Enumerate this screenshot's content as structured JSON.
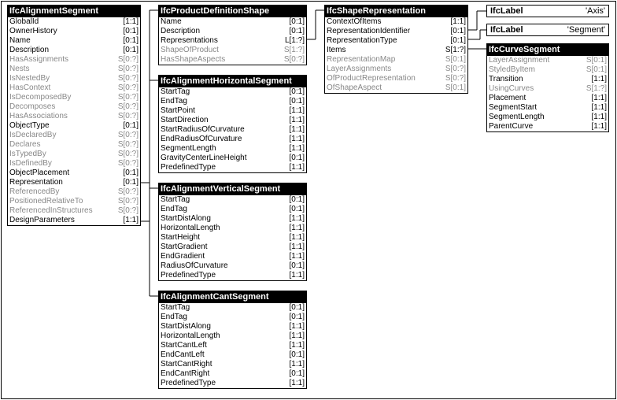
{
  "entities": {
    "alignSeg": {
      "title": "IfcAlignmentSegment",
      "rows": [
        {
          "name": "GlobalId",
          "card": "[1:1]",
          "grey": false
        },
        {
          "name": "OwnerHistory",
          "card": "[0:1]",
          "grey": false
        },
        {
          "name": "Name",
          "card": "[0:1]",
          "grey": false
        },
        {
          "name": "Description",
          "card": "[0:1]",
          "grey": false
        },
        {
          "name": "HasAssignments",
          "card": "S[0:?]",
          "grey": true
        },
        {
          "name": "Nests",
          "card": "S[0:?]",
          "grey": true
        },
        {
          "name": "IsNestedBy",
          "card": "S[0:?]",
          "grey": true
        },
        {
          "name": "HasContext",
          "card": "S[0:?]",
          "grey": true
        },
        {
          "name": "IsDecomposedBy",
          "card": "S[0:?]",
          "grey": true
        },
        {
          "name": "Decomposes",
          "card": "S[0:?]",
          "grey": true
        },
        {
          "name": "HasAssociations",
          "card": "S[0:?]",
          "grey": true
        },
        {
          "name": "ObjectType",
          "card": "[0:1]",
          "grey": false
        },
        {
          "name": "IsDeclaredBy",
          "card": "S[0:?]",
          "grey": true
        },
        {
          "name": "Declares",
          "card": "S[0:?]",
          "grey": true
        },
        {
          "name": "IsTypedBy",
          "card": "S[0:?]",
          "grey": true
        },
        {
          "name": "IsDefinedBy",
          "card": "S[0:?]",
          "grey": true
        },
        {
          "name": "ObjectPlacement",
          "card": "[0:1]",
          "grey": false
        },
        {
          "name": "Representation",
          "card": "[0:1]",
          "grey": false
        },
        {
          "name": "ReferencedBy",
          "card": "S[0:?]",
          "grey": true
        },
        {
          "name": "PositionedRelativeTo",
          "card": "S[0:?]",
          "grey": true
        },
        {
          "name": "ReferencedInStructures",
          "card": "S[0:?]",
          "grey": true
        },
        {
          "name": "DesignParameters",
          "card": "[1:1]",
          "grey": false
        }
      ]
    },
    "prodDef": {
      "title": "IfcProductDefinitionShape",
      "rows": [
        {
          "name": "Name",
          "card": "[0:1]",
          "grey": false
        },
        {
          "name": "Description",
          "card": "[0:1]",
          "grey": false
        },
        {
          "name": "Representations",
          "card": "L[1:?]",
          "grey": false
        },
        {
          "name": "ShapeOfProduct",
          "card": "S[1:?]",
          "grey": true
        },
        {
          "name": "HasShapeAspects",
          "card": "S[0:?]",
          "grey": true
        }
      ]
    },
    "horiz": {
      "title": "IfcAlignmentHorizontalSegment",
      "rows": [
        {
          "name": "StartTag",
          "card": "[0:1]",
          "grey": false
        },
        {
          "name": "EndTag",
          "card": "[0:1]",
          "grey": false
        },
        {
          "name": "StartPoint",
          "card": "[1:1]",
          "grey": false
        },
        {
          "name": "StartDirection",
          "card": "[1:1]",
          "grey": false
        },
        {
          "name": "StartRadiusOfCurvature",
          "card": "[1:1]",
          "grey": false
        },
        {
          "name": "EndRadiusOfCurvature",
          "card": "[1:1]",
          "grey": false
        },
        {
          "name": "SegmentLength",
          "card": "[1:1]",
          "grey": false
        },
        {
          "name": "GravityCenterLineHeight",
          "card": "[0:1]",
          "grey": false
        },
        {
          "name": "PredefinedType",
          "card": "[1:1]",
          "grey": false
        }
      ]
    },
    "vert": {
      "title": "IfcAlignmentVerticalSegment",
      "rows": [
        {
          "name": "StartTag",
          "card": "[0:1]",
          "grey": false
        },
        {
          "name": "EndTag",
          "card": "[0:1]",
          "grey": false
        },
        {
          "name": "StartDistAlong",
          "card": "[1:1]",
          "grey": false
        },
        {
          "name": "HorizontalLength",
          "card": "[1:1]",
          "grey": false
        },
        {
          "name": "StartHeight",
          "card": "[1:1]",
          "grey": false
        },
        {
          "name": "StartGradient",
          "card": "[1:1]",
          "grey": false
        },
        {
          "name": "EndGradient",
          "card": "[1:1]",
          "grey": false
        },
        {
          "name": "RadiusOfCurvature",
          "card": "[0:1]",
          "grey": false
        },
        {
          "name": "PredefinedType",
          "card": "[1:1]",
          "grey": false
        }
      ]
    },
    "cant": {
      "title": "IfcAlignmentCantSegment",
      "rows": [
        {
          "name": "StartTag",
          "card": "[0:1]",
          "grey": false
        },
        {
          "name": "EndTag",
          "card": "[0:1]",
          "grey": false
        },
        {
          "name": "StartDistAlong",
          "card": "[1:1]",
          "grey": false
        },
        {
          "name": "HorizontalLength",
          "card": "[1:1]",
          "grey": false
        },
        {
          "name": "StartCantLeft",
          "card": "[1:1]",
          "grey": false
        },
        {
          "name": "EndCantLeft",
          "card": "[0:1]",
          "grey": false
        },
        {
          "name": "StartCantRight",
          "card": "[1:1]",
          "grey": false
        },
        {
          "name": "EndCantRight",
          "card": "[0:1]",
          "grey": false
        },
        {
          "name": "PredefinedType",
          "card": "[1:1]",
          "grey": false
        }
      ]
    },
    "shapeRep": {
      "title": "IfcShapeRepresentation",
      "rows": [
        {
          "name": "ContextOfItems",
          "card": "[1:1]",
          "grey": false
        },
        {
          "name": "RepresentationIdentifier",
          "card": "[0:1]",
          "grey": false
        },
        {
          "name": "RepresentationType",
          "card": "[0:1]",
          "grey": false
        },
        {
          "name": "Items",
          "card": "S[1:?]",
          "grey": false
        },
        {
          "name": "RepresentationMap",
          "card": "S[0:1]",
          "grey": true
        },
        {
          "name": "LayerAssignments",
          "card": "S[0:?]",
          "grey": true
        },
        {
          "name": "OfProductRepresentation",
          "card": "S[0:?]",
          "grey": true
        },
        {
          "name": "OfShapeAspect",
          "card": "S[0:1]",
          "grey": true
        }
      ]
    },
    "curveSeg": {
      "title": "IfcCurveSegment",
      "rows": [
        {
          "name": "LayerAssignment",
          "card": "S[0:1]",
          "grey": true
        },
        {
          "name": "StyledByItem",
          "card": "S[0:1]",
          "grey": true
        },
        {
          "name": "Transition",
          "card": "[1:1]",
          "grey": false
        },
        {
          "name": "UsingCurves",
          "card": "S[1:?]",
          "grey": true
        },
        {
          "name": "Placement",
          "card": "[1:1]",
          "grey": false
        },
        {
          "name": "SegmentStart",
          "card": "[1:1]",
          "grey": false
        },
        {
          "name": "SegmentLength",
          "card": "[1:1]",
          "grey": false
        },
        {
          "name": "ParentCurve",
          "card": "[1:1]",
          "grey": false
        }
      ]
    }
  },
  "labels": {
    "axis": {
      "key": "IfcLabel",
      "val": "'Axis'"
    },
    "segment": {
      "key": "IfcLabel",
      "val": "'Segment'"
    }
  }
}
